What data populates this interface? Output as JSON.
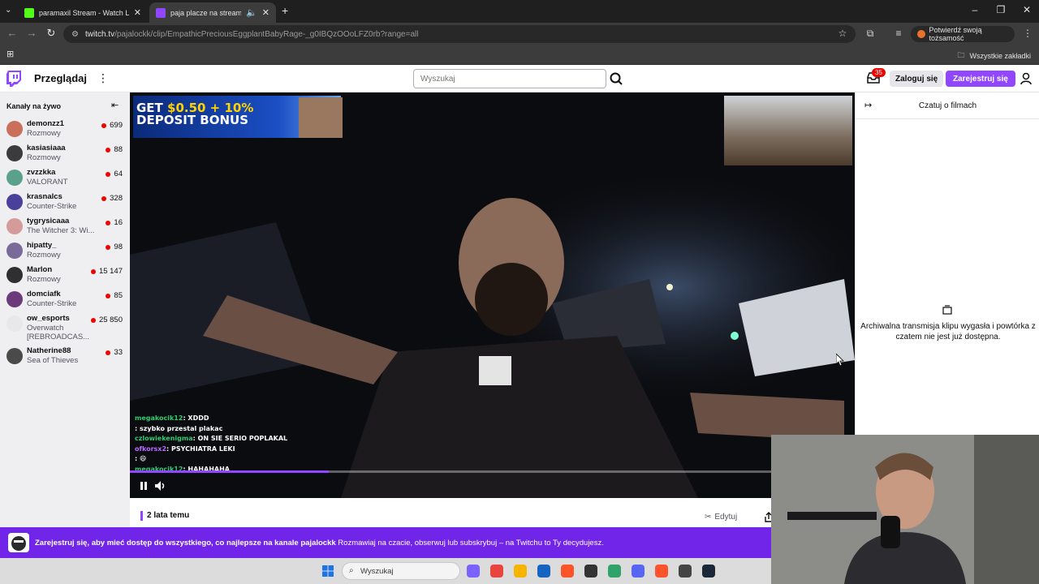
{
  "browser": {
    "tabs": [
      {
        "title": "paramaxil Stream - Watch Live o",
        "favicon_color": "#53fc18",
        "active": false
      },
      {
        "title": "paja placze na streamie - Tw",
        "favicon_color": "#9147ff",
        "active": true
      }
    ],
    "new_tab": "+",
    "url_host": "twitch.tv",
    "url_path": "/pajalockk/clip/EmpathicPreciousEggplantBabyRage-_g0IBQzOOoLFZ0rb?range=all",
    "verify_label": "Potwierdź swoją tożsamość",
    "bookmarks_all": "Wszystkie zakładki"
  },
  "twitch": {
    "browse": "Przeglądaj",
    "search_placeholder": "Wyszukaj",
    "notif_count": "35",
    "login": "Zaloguj się",
    "signup": "Zarejestruj się",
    "brand_color": "#9147ff"
  },
  "sidebar": {
    "title": "Kanały na żywo",
    "channels": [
      {
        "name": "demonzz1",
        "game": "Rozmowy",
        "viewers": "699",
        "color": "#c96f5a"
      },
      {
        "name": "kasiasiaaa",
        "game": "Rozmowy",
        "viewers": "88",
        "color": "#3b3b3b"
      },
      {
        "name": "zvzzkka",
        "game": "VALORANT",
        "viewers": "64",
        "color": "#5aa08a"
      },
      {
        "name": "krasnalcs",
        "game": "Counter-Strike",
        "viewers": "328",
        "color": "#4a3f9a"
      },
      {
        "name": "tygrysicaaa",
        "game": "The Witcher 3: Wi...",
        "viewers": "16",
        "color": "#d59a9a"
      },
      {
        "name": "hipatty_",
        "game": "Rozmowy",
        "viewers": "98",
        "color": "#7a6a9a"
      },
      {
        "name": "Marlon",
        "game": "Rozmowy",
        "viewers": "15 147",
        "color": "#2f2f2f"
      },
      {
        "name": "domciafk",
        "game": "Counter-Strike",
        "viewers": "85",
        "color": "#6a3a7a"
      },
      {
        "name": "ow_esports",
        "game": "Overwatch",
        "game2": "[REBROADCAS...",
        "viewers": "25 850",
        "color": "#e8e8e8"
      },
      {
        "name": "Natherine88",
        "game": "Sea of Thieves",
        "viewers": "33",
        "color": "#4a4a4a"
      }
    ]
  },
  "video": {
    "ad_line1_a": "GET ",
    "ad_line1_b": "$0.50 + 10%",
    "ad_line2": "DEPOSIT BONUS",
    "chat": [
      {
        "user": "megakocik12",
        "text": ": XDDD",
        "cls": "cm-user"
      },
      {
        "user": "",
        "text": ": szybko przestal plakac",
        "cls": "cm-user2"
      },
      {
        "user": "czlowiekenigma",
        "text": ": ON SIE SERIO POPLAKAL",
        "cls": "cm-user"
      },
      {
        "user": "ofkorsx2",
        "text": ": PSYCHIATRA   LEKI",
        "cls": "cm-user2"
      },
      {
        "user": "",
        "text": ": 😄",
        "cls": "cm-user"
      },
      {
        "user": "megakocik12",
        "text": ": HAHAHAHA",
        "cls": "cm-user"
      }
    ],
    "progress": 0.31
  },
  "clip": {
    "date": "2 lata temu",
    "edit": "Edytuj"
  },
  "chat": {
    "title": "Czatuj o filmach",
    "message": "Archiwalna transmisja klipu wygasła i powtórka z czatem nie jest już dostępna."
  },
  "promo": {
    "bold": "Zarejestruj się, aby mieć dostęp do wszystkiego, co najlepsze na kanale pajalockk",
    "rest": "  Rozmawiaj na czacie, obserwuj lub subskrybuj – na Twitchu to Ty decydujesz."
  },
  "taskbar": {
    "search": "Wyszukaj",
    "icons": [
      "copilot-icon",
      "chrome-icon",
      "explorer-icon",
      "store-icon",
      "brave-icon",
      "app-icon",
      "network-icon",
      "discord-icon",
      "brave-alt-icon",
      "app2-icon",
      "steam-icon"
    ]
  }
}
